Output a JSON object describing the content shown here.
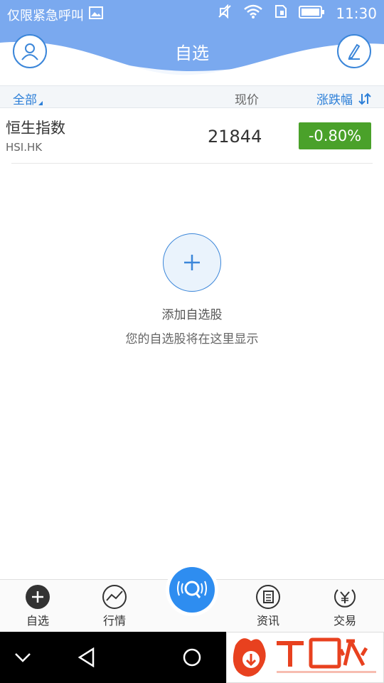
{
  "status_bar": {
    "carrier": "仅限紧急呼叫",
    "time": "11:30"
  },
  "header": {
    "title": "自选",
    "left_icon": "user-icon",
    "right_icon": "edit-icon"
  },
  "columns": {
    "all": "全部",
    "price": "现价",
    "change": "涨跌幅"
  },
  "stocks": [
    {
      "name": "恒生指数",
      "code": "HSI.HK",
      "price": "21844",
      "change": "-0.80%",
      "change_color": "#4aa12a"
    }
  ],
  "empty_state": {
    "title": "添加自选股",
    "subtitle": "您的自选股将在这里显示"
  },
  "tabs": [
    {
      "label": "自选",
      "icon": "plus-circle-icon"
    },
    {
      "label": "行情",
      "icon": "chart-icon"
    },
    {
      "label": "",
      "icon": "voice-search-icon"
    },
    {
      "label": "资讯",
      "icon": "news-icon"
    },
    {
      "label": "交易",
      "icon": "yen-icon"
    }
  ],
  "watermark": {
    "brand": "下载火",
    "url": "xiazaihuo.com"
  },
  "colors": {
    "header": "#6fa6ee",
    "accent": "#2c7fd8",
    "down_badge": "#4aa12a"
  }
}
